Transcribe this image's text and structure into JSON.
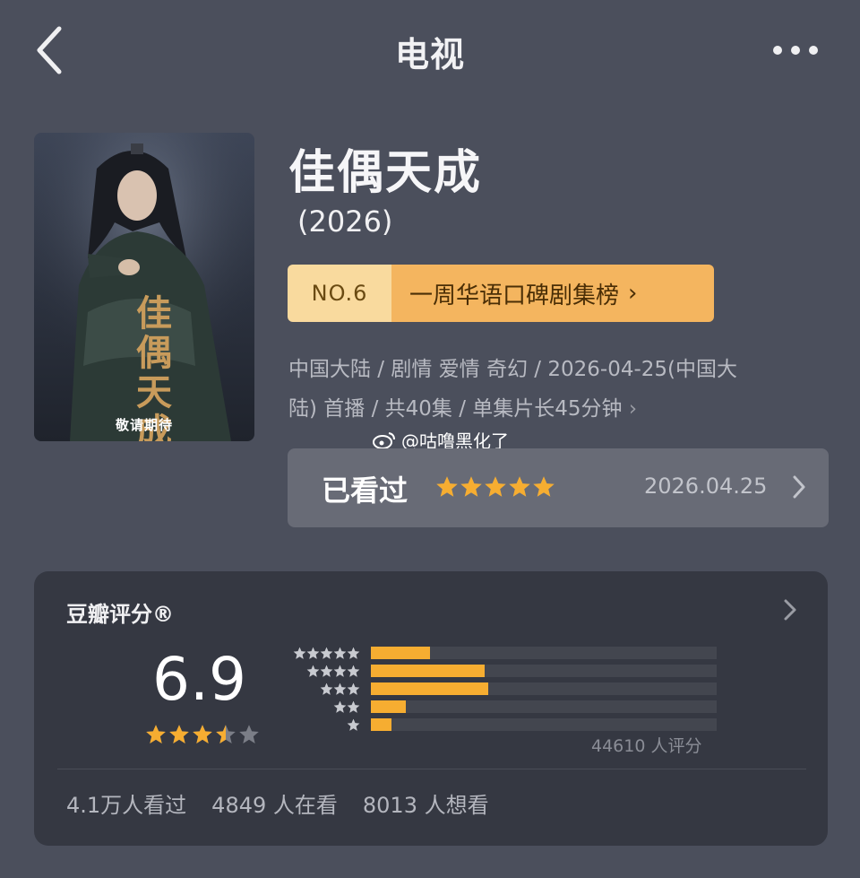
{
  "header": {
    "title": "电视",
    "back_icon": "chevron-left-icon",
    "more_icon": "more-horizontal-icon"
  },
  "poster": {
    "vertical_title": "佳偶天成",
    "caption": "敬请期待"
  },
  "show": {
    "title": "佳偶天成",
    "year": "(2026)",
    "rank": {
      "no": "NO.6",
      "name": "一周华语口碑剧集榜",
      "chevron": "›"
    },
    "meta_line1": "中国大陆 / 剧情 爱情 奇幻 / 2026-04-25(中国大",
    "meta_line2": "陆) 首播 / 共40集 / 单集片长45分钟",
    "meta_chevron": "›"
  },
  "watermark": {
    "text": "@咕噜黑化了",
    "icon": "weibo-icon"
  },
  "watched": {
    "label": "已看过",
    "my_stars": 5,
    "date": "2026.04.25"
  },
  "rating": {
    "title": "豆瓣评分®",
    "score": "6.9",
    "star_fill": 3.5,
    "distribution": [
      {
        "stars": 5,
        "fraction": 0.17
      },
      {
        "stars": 4,
        "fraction": 0.33
      },
      {
        "stars": 3,
        "fraction": 0.34
      },
      {
        "stars": 2,
        "fraction": 0.1
      },
      {
        "stars": 1,
        "fraction": 0.06
      }
    ],
    "count": "44610 人评分",
    "stats": {
      "watched": "4.1万人看过",
      "watching": "4849 人在看",
      "want": "8013 人想看"
    }
  },
  "colors": {
    "background": "#4b4f5c",
    "card": "#353842",
    "star": "#f6ad31",
    "rank_light": "#f9da9e",
    "rank_dark": "#f4b55f"
  }
}
